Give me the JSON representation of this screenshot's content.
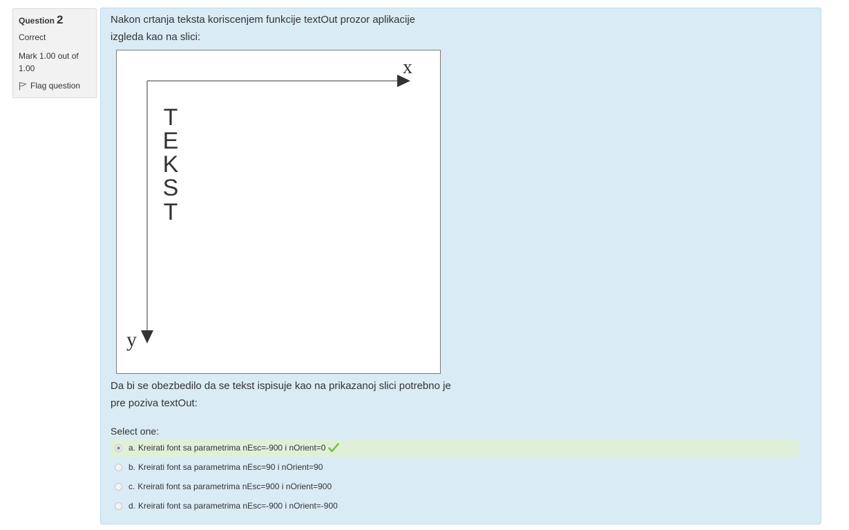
{
  "info": {
    "question_label": "Question",
    "question_number": "2",
    "state": "Correct",
    "grade": "Mark 1.00 out of 1.00",
    "flag_label": "Flag question"
  },
  "question": {
    "text_line1": "Nakon crtanja teksta koriscenjem funkcije textOut prozor aplikacije",
    "text_line2": "izgleda kao na slici:",
    "figure": {
      "x_label": "x",
      "y_label": "y",
      "letters": [
        "T",
        "E",
        "K",
        "S",
        "T"
      ]
    },
    "text_line3": "Da bi se obezbedilo da se tekst ispisuje kao na prikazanoj slici potrebno je",
    "text_line4": "pre poziva textOut:",
    "prompt": "Select one:"
  },
  "answers": [
    {
      "letter": "a.",
      "text": "Kreirati font sa parametrima nEsc=-900 i nOrient=0",
      "selected": true,
      "correct": true
    },
    {
      "letter": "b.",
      "text": "Kreirati font sa parametrima nEsc=90 i nOrient=90",
      "selected": false,
      "correct": false
    },
    {
      "letter": "c.",
      "text": "Kreirati font sa parametrima nEsc=900 i nOrient=900",
      "selected": false,
      "correct": false
    },
    {
      "letter": "d.",
      "text": "Kreirati font sa parametrima nEsc=-900 i nOrient=-900",
      "selected": false,
      "correct": false
    }
  ],
  "colors": {
    "content_bg": "#d9ebf5",
    "correct_bg": "#dff0d8",
    "check_color": "#7cc242"
  }
}
